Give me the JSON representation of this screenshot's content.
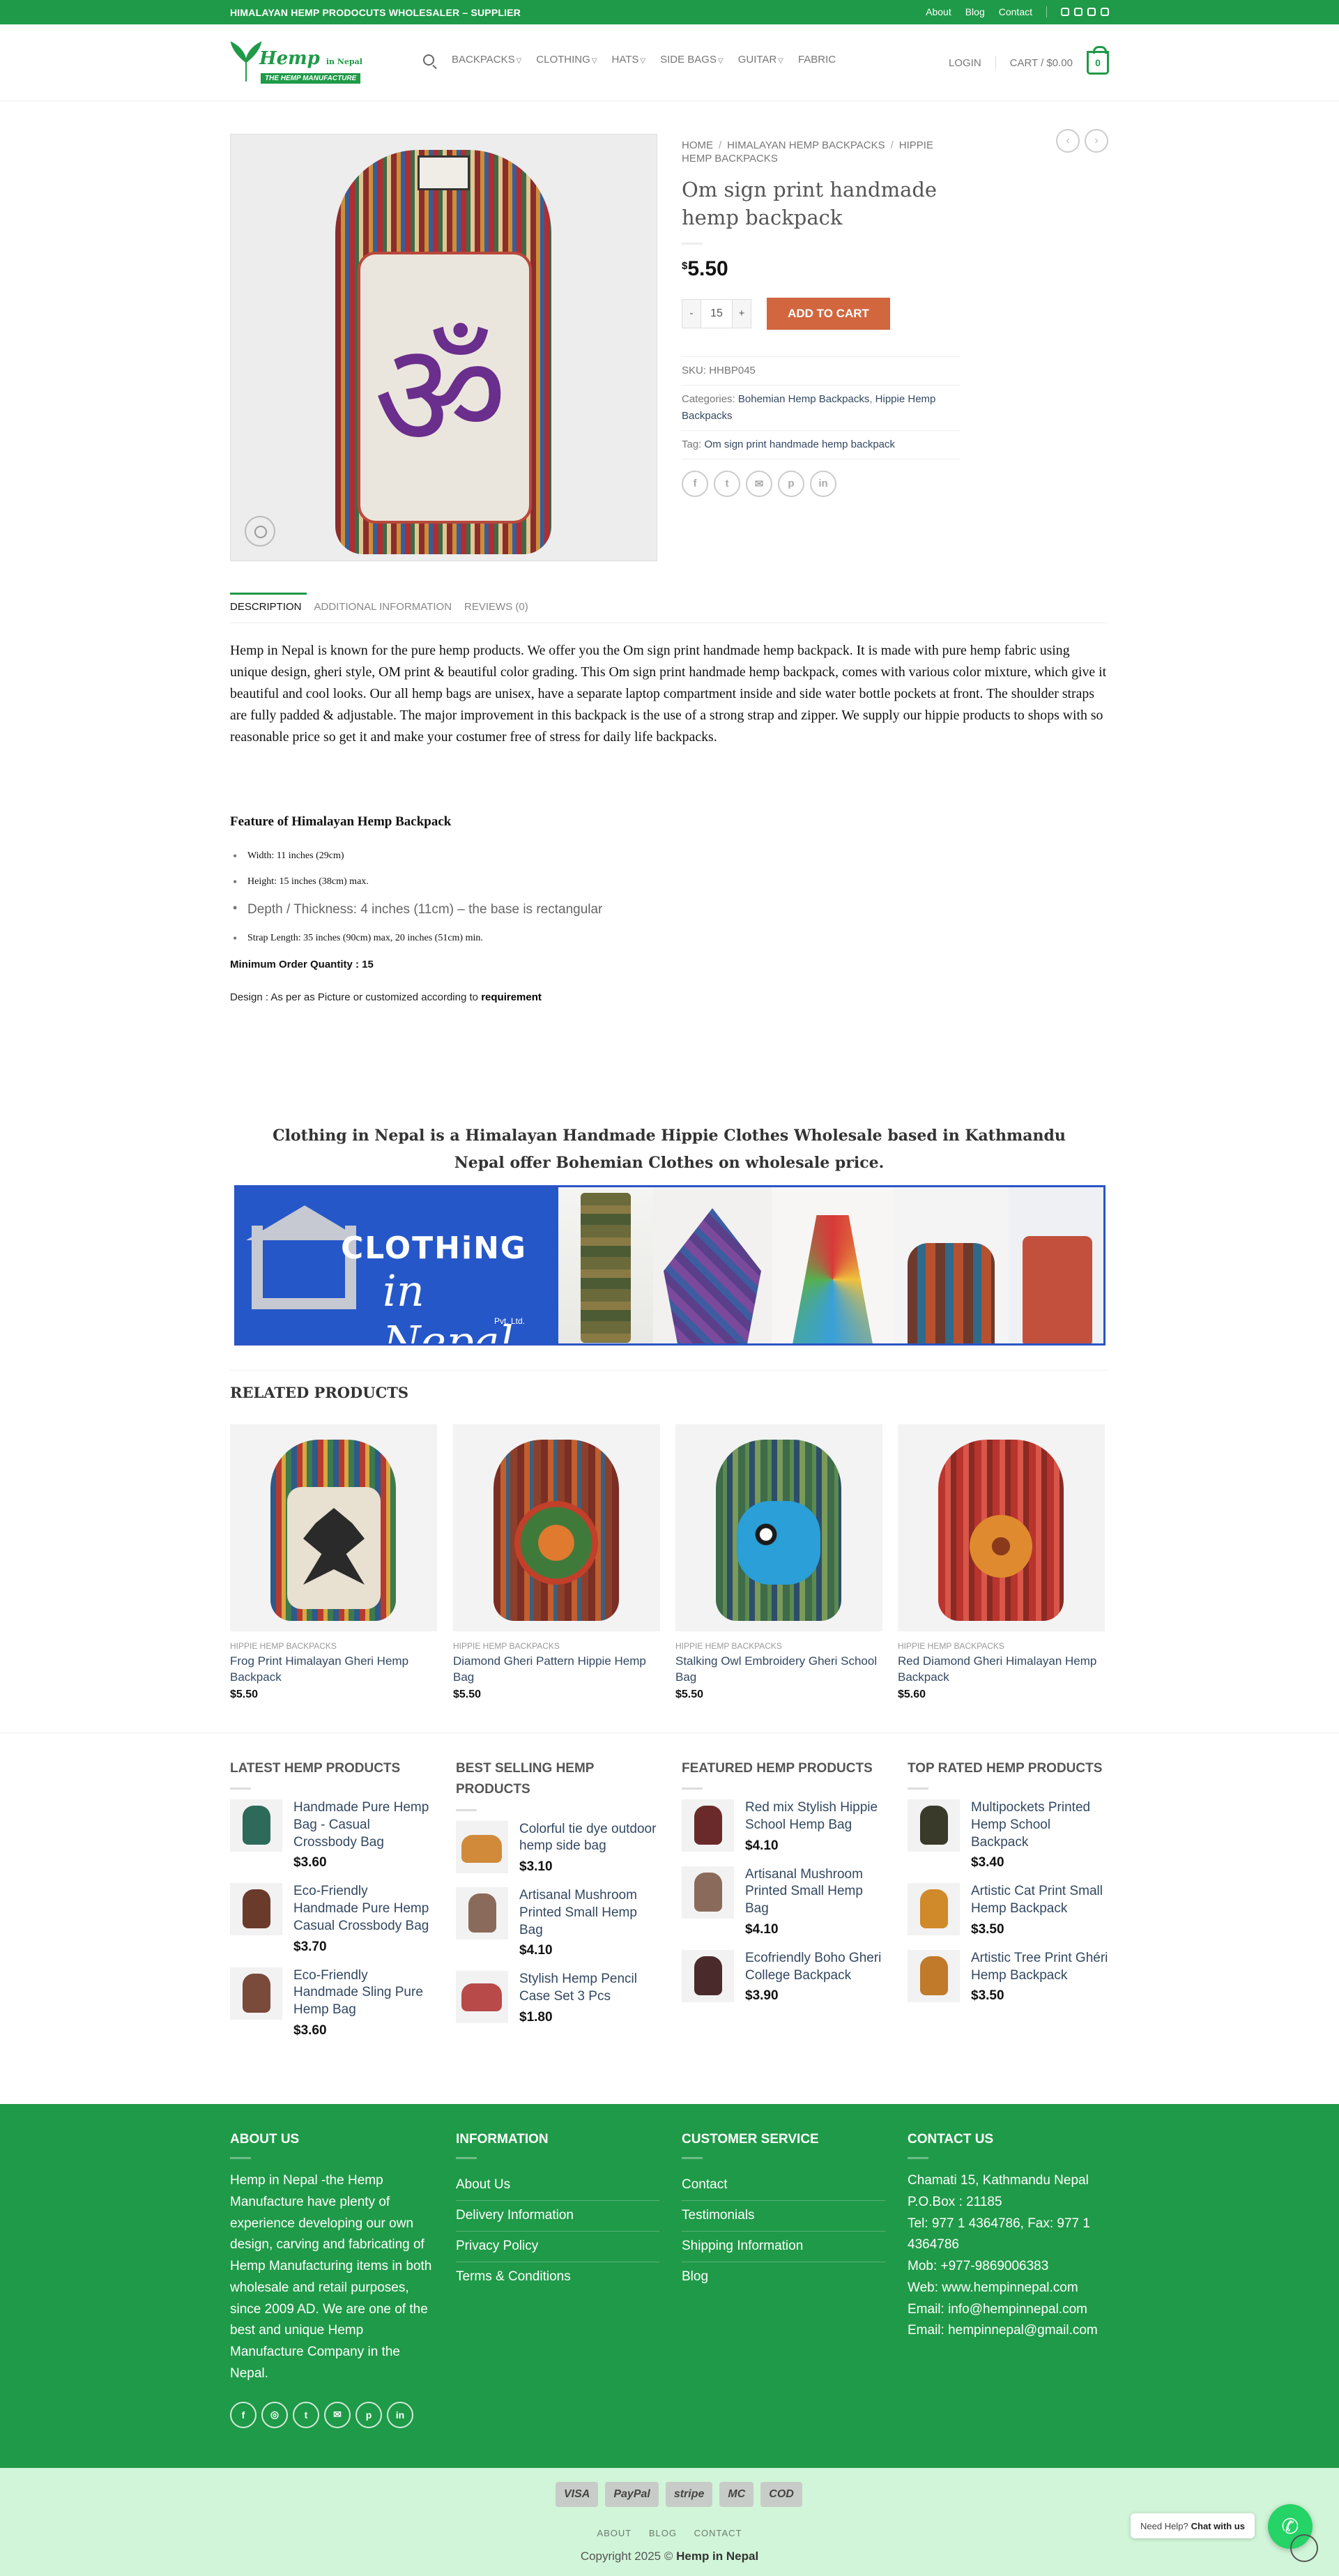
{
  "topbar": {
    "message": "HIMALAYAN HEMP PRODOCUTS WHOLESALER – SUPPLIER",
    "links": [
      "About",
      "Blog",
      "Contact"
    ],
    "socials": [
      "facebook-icon",
      "instagram-icon",
      "twitter-icon",
      "email-icon"
    ]
  },
  "header": {
    "logo_brand": "Hemp",
    "logo_brand_small": "in Nepal",
    "logo_tagline": "THE HEMP MANUFACTURE",
    "nav": [
      {
        "label": "BACKPACKS",
        "dropdown": true
      },
      {
        "label": "CLOTHING",
        "dropdown": true
      },
      {
        "label": "HATS",
        "dropdown": true
      },
      {
        "label": "SIDE BAGS",
        "dropdown": true
      },
      {
        "label": "GUITAR",
        "dropdown": true
      },
      {
        "label": "FABRIC",
        "dropdown": false
      }
    ],
    "login": "LOGIN",
    "cart_label": "CART / $0.00",
    "cart_count": "0"
  },
  "product": {
    "breadcrumb": [
      "HOME",
      "HIMALAYAN HEMP BACKPACKS",
      "HIPPIE HEMP BACKPACKS"
    ],
    "title": "Om sign print handmade hemp backpack",
    "currency": "$",
    "price": "5.50",
    "qty_minus": "-",
    "qty_value": "15",
    "qty_plus": "+",
    "add_to_cart": "Add to cart",
    "sku_label": "SKU:",
    "sku": "HHBP045",
    "categories_label": "Categories:",
    "categories": [
      "Bohemian Hemp Backpacks",
      "Hippie Hemp Backpacks"
    ],
    "tag_label": "Tag:",
    "tag": "Om sign print handmade hemp backpack",
    "image_glyph": "ॐ",
    "share": [
      "facebook-icon",
      "twitter-icon",
      "email-icon",
      "pinterest-icon",
      "linkedin-icon"
    ]
  },
  "tabs": [
    "DESCRIPTION",
    "ADDITIONAL INFORMATION",
    "REVIEWS (0)"
  ],
  "description": {
    "paragraph": "Hemp in Nepal is known for the pure hemp products. We offer you the Om sign print handmade hemp backpack. It is made with pure hemp fabric using unique design, gheri style, OM print & beautiful color grading. This Om sign print handmade hemp backpack, comes with various color mixture, which give it beautiful and cool looks. Our all hemp bags are unisex, have a separate laptop compartment inside and side water bottle pockets at front. The shoulder straps are fully padded & adjustable. The major improvement in this backpack is the use of a strong strap and zipper. We supply our hippie products to shops with so reasonable price so get it and make your costumer free of stress for daily life backpacks.",
    "feature_heading": "Feature of Himalayan Hemp Backpack",
    "features": [
      "Width: 11 inches (29cm)",
      "Height: 15 inches (38cm) max.",
      "Depth / Thickness: 4 inches (11cm) – the base is rectangular",
      "Strap Length: 35 inches (90cm) max, 20 inches (51cm) min."
    ],
    "moq": "Minimum Order Quantity : 15",
    "design_text": "Design : As per as Picture or customized according to",
    "design_bold": "requirement"
  },
  "promo": {
    "text": "Clothing in Nepal is a Himalayan Handmade Hippie Clothes Wholesale based in Kathmandu Nepal offer Bohemian Clothes on wholesale price.",
    "banner_title": "CLOTHiNG",
    "banner_sub": "in Nepal",
    "banner_pvt": "Pvt. Ltd."
  },
  "related": {
    "title": "RELATED PRODUCTS",
    "items": [
      {
        "category": "HIPPIE HEMP BACKPACKS",
        "name": "Frog Print Himalayan Gheri Hemp Backpack",
        "price": "$5.50"
      },
      {
        "category": "HIPPIE HEMP BACKPACKS",
        "name": "Diamond Gheri Pattern Hippie Hemp Bag",
        "price": "$5.50"
      },
      {
        "category": "HIPPIE HEMP BACKPACKS",
        "name": "Stalking Owl Embroidery Gheri School Bag",
        "price": "$5.50"
      },
      {
        "category": "HIPPIE HEMP BACKPACKS",
        "name": "Red Diamond Gheri Himalayan Hemp Backpack",
        "price": "$5.60"
      }
    ]
  },
  "widgets": [
    {
      "title": "LATEST HEMP PRODUCTS",
      "items": [
        {
          "name": "Handmade Pure Hemp Bag - Casual Crossbody Bag",
          "price": "$3.60"
        },
        {
          "name": "Eco-Friendly Handmade Pure Hemp Casual Crossbody Bag",
          "price": "$3.70"
        },
        {
          "name": "Eco-Friendly Handmade Sling Pure Hemp Bag",
          "price": "$3.60"
        }
      ]
    },
    {
      "title": "BEST SELLING HEMP PRODUCTS",
      "items": [
        {
          "name": "Colorful tie dye outdoor hemp side bag",
          "price": "$3.10"
        },
        {
          "name": "Artisanal Mushroom Printed Small Hemp Bag",
          "price": "$4.10"
        },
        {
          "name": "Stylish Hemp Pencil Case Set 3 Pcs",
          "price": "$1.80"
        }
      ]
    },
    {
      "title": "FEATURED HEMP PRODUCTS",
      "items": [
        {
          "name": "Red mix Stylish Hippie School Hemp Bag",
          "price": "$4.10"
        },
        {
          "name": "Artisanal Mushroom Printed Small Hemp Bag",
          "price": "$4.10"
        },
        {
          "name": "Ecofriendly Boho Gheri College Backpack",
          "price": "$3.90"
        }
      ]
    },
    {
      "title": "TOP RATED HEMP PRODUCTS",
      "items": [
        {
          "name": "Multipockets Printed Hemp School Backpack",
          "price": "$3.40"
        },
        {
          "name": "Artistic Cat Print Small Hemp Backpack",
          "price": "$3.50"
        },
        {
          "name": "Artistic Tree Print Ghéri Hemp Backpack",
          "price": "$3.50"
        }
      ]
    }
  ],
  "footer": {
    "about_title": "ABOUT US",
    "about_text": "Hemp in Nepal -the Hemp Manufacture have plenty of experience developing our own design, carving and fabricating of Hemp Manufacturing items in both wholesale and retail purposes, since 2009 AD. We are one of the best and unique Hemp Manufacture Company in the Nepal.",
    "socials": [
      "facebook-icon",
      "instagram-icon",
      "twitter-icon",
      "email-icon",
      "pinterest-icon",
      "linkedin-icon"
    ],
    "info_title": "INFORMATION",
    "info_links": [
      "About Us",
      "Delivery Information",
      "Privacy Policy",
      "Terms & Conditions"
    ],
    "service_title": "CUSTOMER SERVICE",
    "service_links": [
      "Contact",
      "Testimonials",
      "Shipping Information",
      "Blog"
    ],
    "contact_title": "CONTACT US",
    "contact_lines": [
      "Chamati 15, Kathmandu Nepal",
      "P.O.Box : 21185",
      "Tel: 977 1 4364786, Fax: 977 1 4364786",
      "Mob: +977-9869006383",
      "Web: www.hempinnepal.com",
      "Email: info@hempinnepal.com",
      "Email: hempinnepal@gmail.com"
    ]
  },
  "bottom": {
    "payments": [
      "VISA",
      "PayPal",
      "stripe",
      "MC",
      "COD"
    ],
    "links": [
      "ABOUT",
      "BLOG",
      "CONTACT"
    ],
    "copyright": "Copyright 2025 ©",
    "copyright_brand": "Hemp in Nepal",
    "help_text": "Need Help?",
    "help_bold": "Chat with us"
  },
  "colors": {
    "brand_green": "#1f9a48",
    "add_to_cart": "#d1663f",
    "link": "#334862",
    "footer_bottom": "#d1f5d8"
  }
}
